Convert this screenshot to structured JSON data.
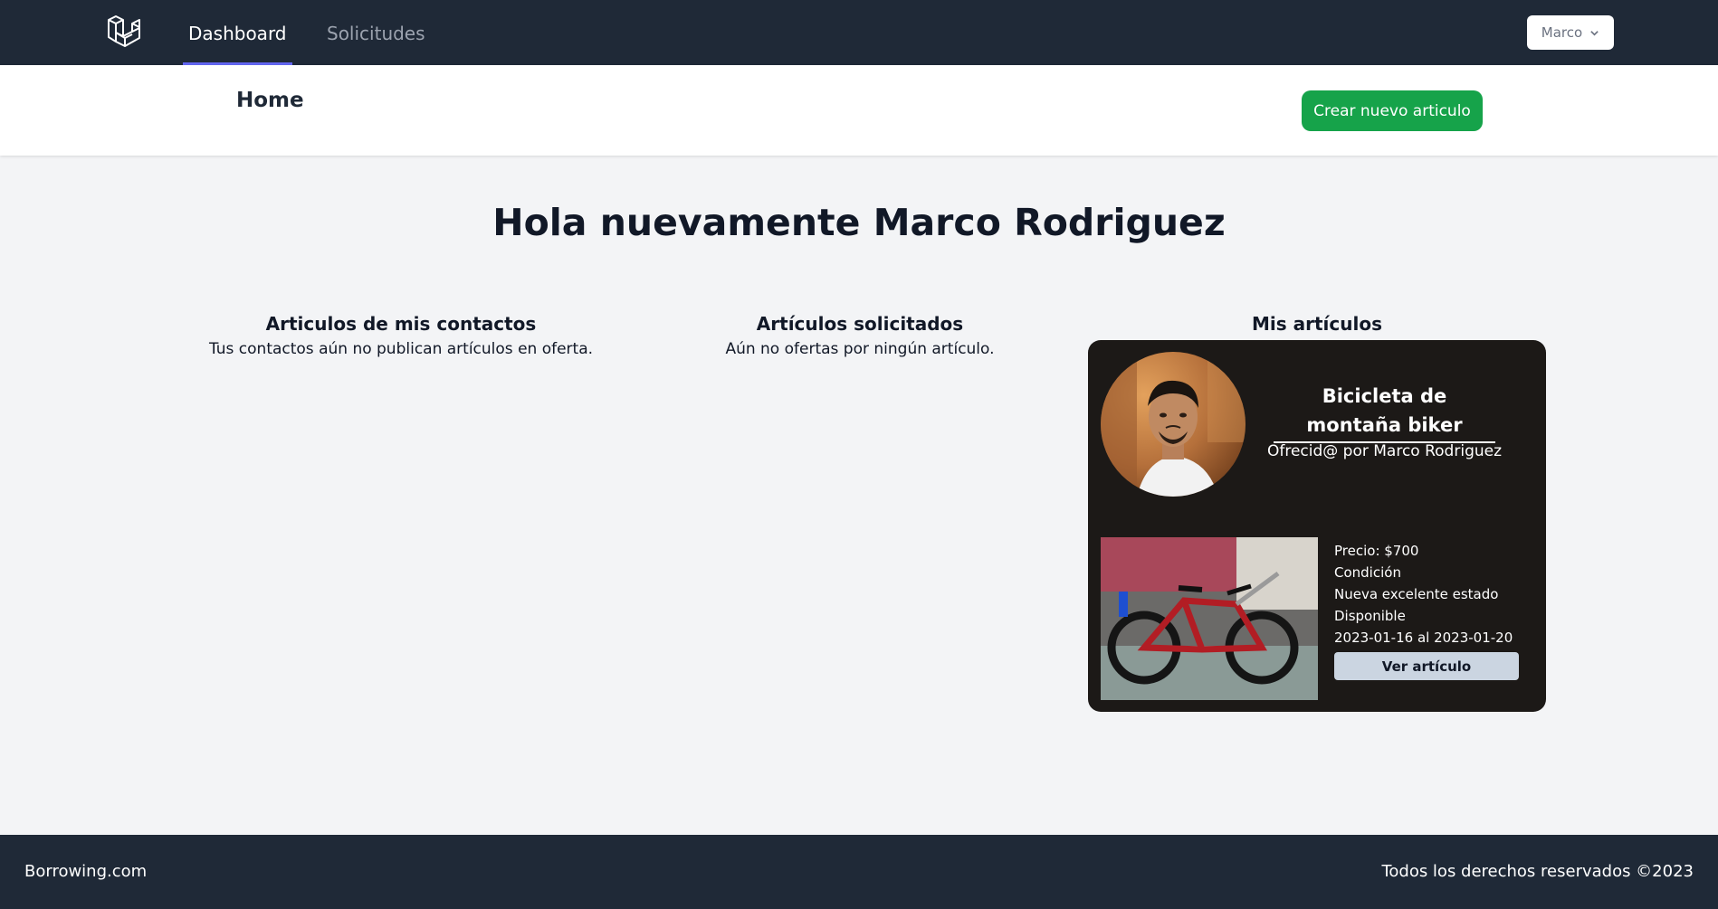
{
  "nav": {
    "logo_icon": "laravel-logo-icon",
    "links": [
      {
        "label": "Dashboard",
        "active": true
      },
      {
        "label": "Solicitudes",
        "active": false
      }
    ],
    "user": {
      "name": "Marco",
      "icon": "chevron-down-icon"
    }
  },
  "header": {
    "title": "Home",
    "create_button": "Crear nuevo articulo"
  },
  "main": {
    "greeting": "Hola nuevamente Marco Rodriguez",
    "columns": [
      {
        "heading": "Articulos de mis contactos",
        "text": "Tus contactos aún no publican artículos en oferta."
      },
      {
        "heading": "Artículos solicitados",
        "text": "Aún no ofertas por ningún artículo."
      },
      {
        "heading": "Mis artículos"
      }
    ],
    "card": {
      "title": "Bicicleta de montaña biker",
      "owner": "Ofrecid@ por Marco Rodriguez",
      "price": "Precio: $700",
      "condition_label": "Condición",
      "condition_value": "Nueva excelente estado",
      "availability_label": "Disponible",
      "availability_dates": "2023-01-16 al 2023-01-20",
      "view_button": "Ver artículo"
    }
  },
  "footer": {
    "brand": "Borrowing.com",
    "copyright": "Todos los derechos reservados ©2023"
  },
  "colors": {
    "nav_bg": "#1f2937",
    "accent": "#6366f1",
    "create_button": "#16a34a",
    "card_bg": "#1c1917",
    "view_button": "#cbd5e1"
  }
}
